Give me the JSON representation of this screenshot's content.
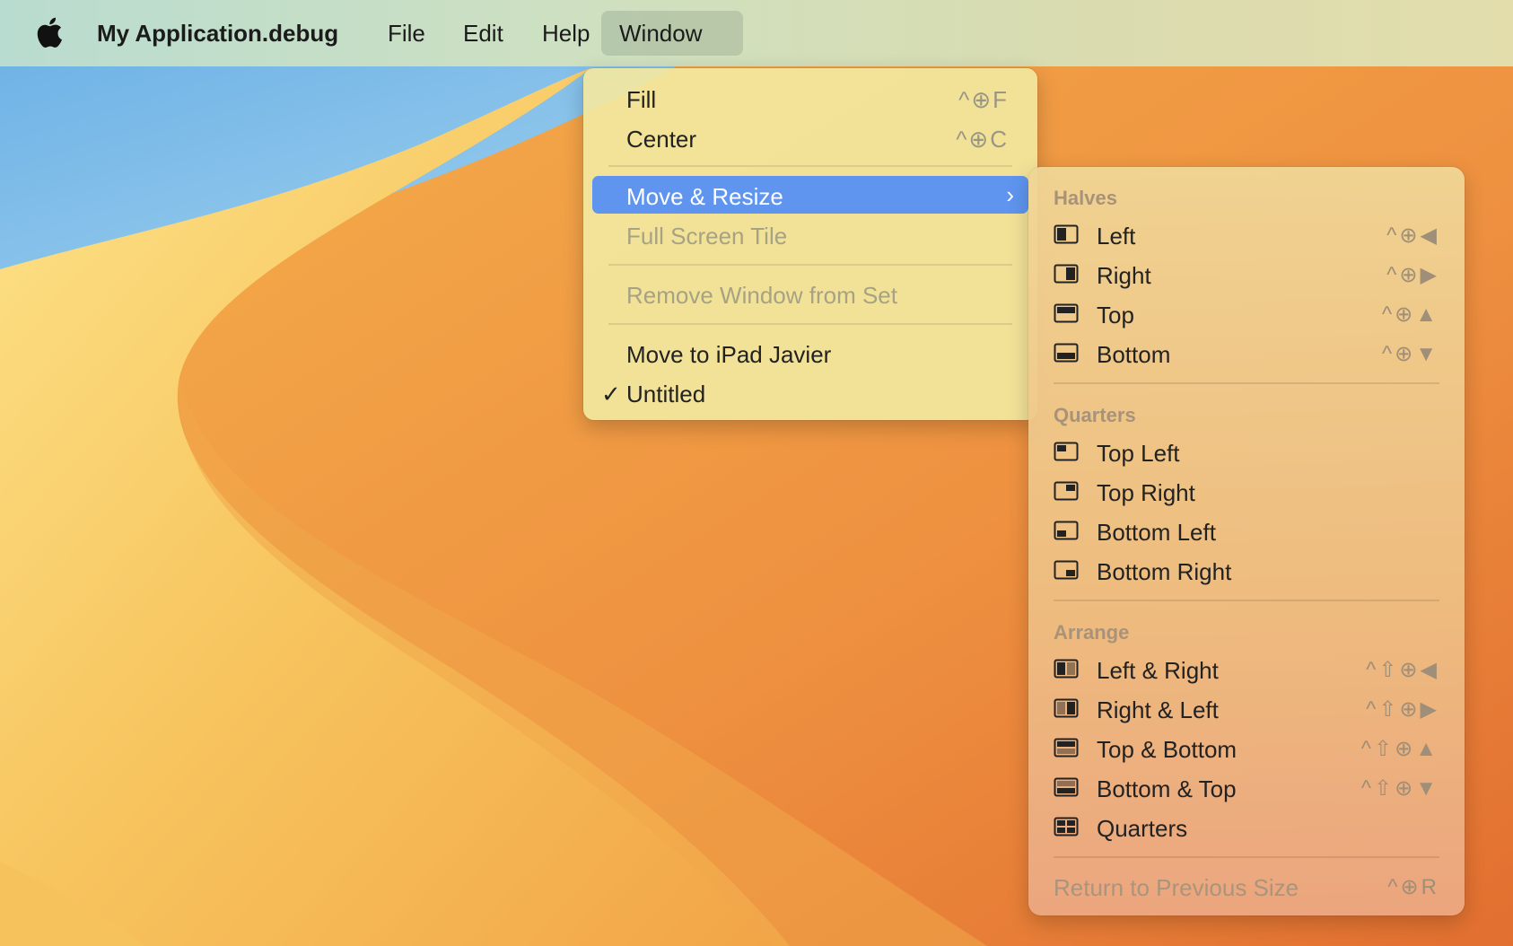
{
  "menubar": {
    "apple_icon": "apple-logo-icon",
    "app_name": "My Application.debug",
    "items": [
      "File",
      "Edit",
      "Help",
      "Window"
    ],
    "active": "Window"
  },
  "window_menu": {
    "fill": {
      "label": "Fill",
      "shortcut": "^⊕F"
    },
    "center": {
      "label": "Center",
      "shortcut": "^⊕C"
    },
    "move_resize": {
      "label": "Move & Resize"
    },
    "full_screen_tile": {
      "label": "Full Screen Tile"
    },
    "remove_from_set": {
      "label": "Remove Window from Set"
    },
    "move_to_ipad": {
      "label": "Move to iPad Javier"
    },
    "untitled": {
      "label": "Untitled",
      "check": "✓"
    }
  },
  "submenu": {
    "halves_header": "Halves",
    "halves": [
      {
        "label": "Left",
        "shortcut": "^⊕◀",
        "icon": "half-left-icon"
      },
      {
        "label": "Right",
        "shortcut": "^⊕▶",
        "icon": "half-right-icon"
      },
      {
        "label": "Top",
        "shortcut": "^⊕▲",
        "icon": "half-top-icon"
      },
      {
        "label": "Bottom",
        "shortcut": "^⊕▼",
        "icon": "half-bottom-icon"
      }
    ],
    "quarters_header": "Quarters",
    "quarters": [
      {
        "label": "Top Left",
        "icon": "quarter-top-left-icon"
      },
      {
        "label": "Top Right",
        "icon": "quarter-top-right-icon"
      },
      {
        "label": "Bottom Left",
        "icon": "quarter-bottom-left-icon"
      },
      {
        "label": "Bottom Right",
        "icon": "quarter-bottom-right-icon"
      }
    ],
    "arrange_header": "Arrange",
    "arrange": [
      {
        "label": "Left & Right",
        "shortcut": "^⇧⊕◀",
        "icon": "arrange-left-right-icon"
      },
      {
        "label": "Right & Left",
        "shortcut": "^⇧⊕▶",
        "icon": "arrange-right-left-icon"
      },
      {
        "label": "Top & Bottom",
        "shortcut": "^⇧⊕▲",
        "icon": "arrange-top-bottom-icon"
      },
      {
        "label": "Bottom & Top",
        "shortcut": "^⇧⊕▼",
        "icon": "arrange-bottom-top-icon"
      },
      {
        "label": "Quarters",
        "shortcut": "",
        "icon": "arrange-quarters-icon"
      }
    ],
    "return_previous": {
      "label": "Return to Previous Size",
      "shortcut": "^⊕R"
    }
  },
  "colors": {
    "highlight": "#5f95ef",
    "menu_bg": "#f2e8a0",
    "disabled_text": "#a6a283"
  }
}
